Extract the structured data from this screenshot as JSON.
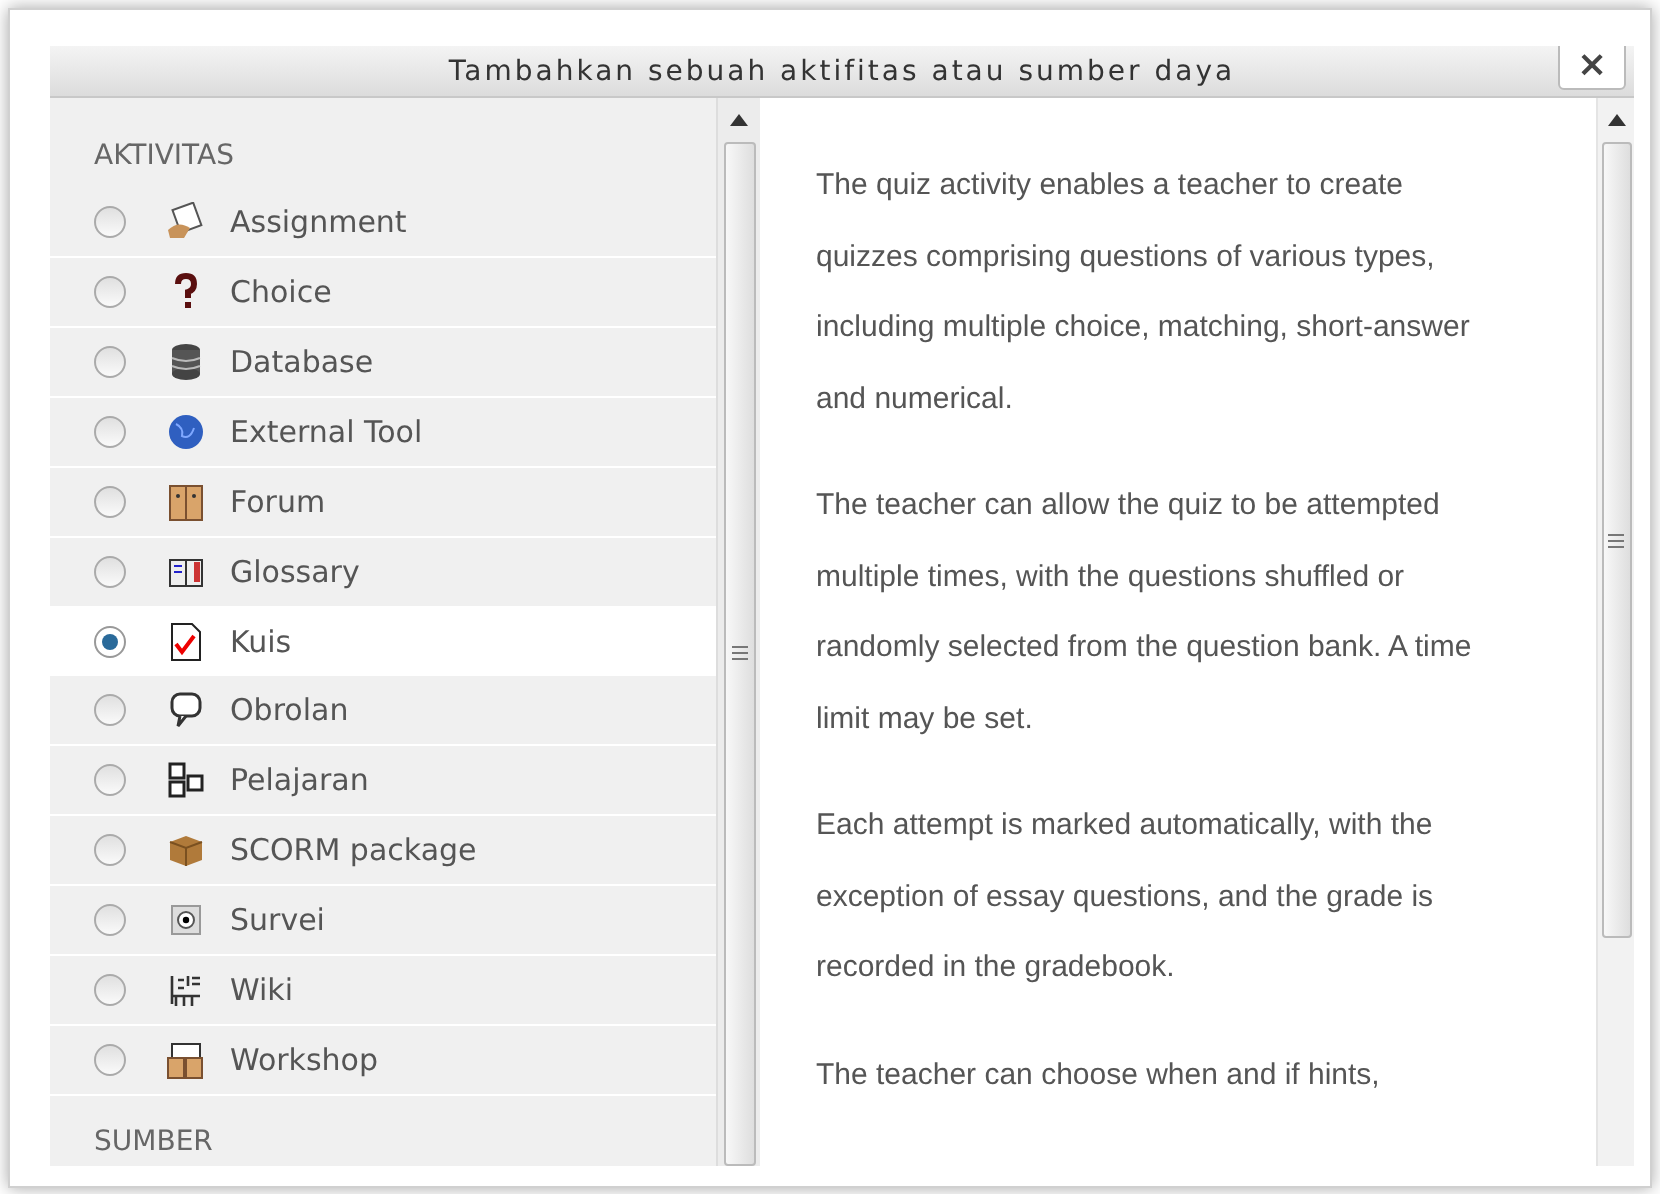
{
  "dialog": {
    "title": "Tambahkan sebuah aktifitas atau sumber daya",
    "close": "×"
  },
  "sections": [
    {
      "heading": "AKTIVITAS",
      "items": [
        {
          "label": "Assignment",
          "selected": false
        },
        {
          "label": "Choice",
          "selected": false
        },
        {
          "label": "Database",
          "selected": false
        },
        {
          "label": "External Tool",
          "selected": false
        },
        {
          "label": "Forum",
          "selected": false
        },
        {
          "label": "Glossary",
          "selected": false
        },
        {
          "label": "Kuis",
          "selected": true
        },
        {
          "label": "Obrolan",
          "selected": false
        },
        {
          "label": "Pelajaran",
          "selected": false
        },
        {
          "label": "SCORM package",
          "selected": false
        },
        {
          "label": "Survei",
          "selected": false
        },
        {
          "label": "Wiki",
          "selected": false
        },
        {
          "label": "Workshop",
          "selected": false
        }
      ]
    },
    {
      "heading": "SUMBER"
    }
  ],
  "description": [
    "The quiz activity enables a teacher to create quizzes comprising questions of various types, including multiple choice, matching, short-answer and numerical.",
    "The teacher can allow the quiz to be attempted multiple times, with the questions shuffled or randomly selected from the question bank. A time limit may be set.",
    "Each attempt is marked automatically, with the exception of essay questions, and the grade is recorded in the gradebook.",
    "The teacher can choose when and if hints,"
  ]
}
